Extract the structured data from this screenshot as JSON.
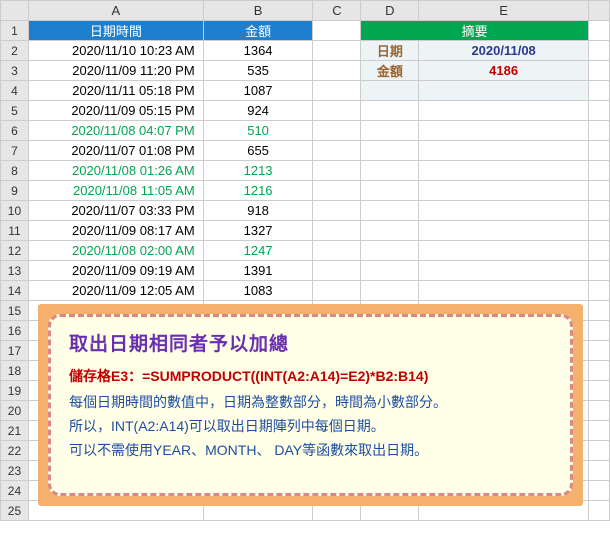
{
  "grid": {
    "columns": [
      "A",
      "B",
      "C",
      "D",
      "E",
      ""
    ],
    "header": {
      "ab_datetime": "日期時間",
      "ab_amount": "金額",
      "d_summary": "摘要"
    },
    "data": [
      {
        "dt": "2020/11/10 10:23 AM",
        "amt": "1364",
        "hl": false
      },
      {
        "dt": "2020/11/09 11:20 PM",
        "amt": "535",
        "hl": false
      },
      {
        "dt": "2020/11/11 05:18 PM",
        "amt": "1087",
        "hl": false
      },
      {
        "dt": "2020/11/09 05:15 PM",
        "amt": "924",
        "hl": false
      },
      {
        "dt": "2020/11/08 04:07 PM",
        "amt": "510",
        "hl": true
      },
      {
        "dt": "2020/11/07 01:08 PM",
        "amt": "655",
        "hl": false
      },
      {
        "dt": "2020/11/08 01:26 AM",
        "amt": "1213",
        "hl": true
      },
      {
        "dt": "2020/11/08 11:05 AM",
        "amt": "1216",
        "hl": true
      },
      {
        "dt": "2020/11/07 03:33 PM",
        "amt": "918",
        "hl": false
      },
      {
        "dt": "2020/11/09 08:17 AM",
        "amt": "1327",
        "hl": false
      },
      {
        "dt": "2020/11/08 02:00 AM",
        "amt": "1247",
        "hl": true
      },
      {
        "dt": "2020/11/09 09:19 AM",
        "amt": "1391",
        "hl": false
      },
      {
        "dt": "2020/11/09 12:05 AM",
        "amt": "1083",
        "hl": false
      }
    ],
    "summary": {
      "date_label": "日期",
      "date_value": "2020/11/08",
      "amt_label": "金額",
      "amt_value": "4186"
    }
  },
  "callout": {
    "title": "取出日期相同者予以加總",
    "formula": "儲存格E3：=SUMPRODUCT((INT(A2:A14)=E2)*B2:B14)",
    "line1": "每個日期時間的數值中，日期為整數部分，時間為小數部分。",
    "line2": "所以，INT(A2:A14)可以取出日期陣列中每個日期。",
    "line3": "可以不需使用YEAR、MONTH、 DAY等函數來取出日期。"
  },
  "chart_data": {
    "type": "table",
    "title": "SUMPRODUCT with INT date filter",
    "columns": [
      "日期時間",
      "金額"
    ],
    "rows": [
      [
        "2020/11/10 10:23 AM",
        1364
      ],
      [
        "2020/11/09 11:20 PM",
        535
      ],
      [
        "2020/11/11 05:18 PM",
        1087
      ],
      [
        "2020/11/09 05:15 PM",
        924
      ],
      [
        "2020/11/08 04:07 PM",
        510
      ],
      [
        "2020/11/07 01:08 PM",
        655
      ],
      [
        "2020/11/08 01:26 AM",
        1213
      ],
      [
        "2020/11/08 11:05 AM",
        1216
      ],
      [
        "2020/11/07 03:33 PM",
        918
      ],
      [
        "2020/11/09 08:17 AM",
        1327
      ],
      [
        "2020/11/08 02:00 AM",
        1247
      ],
      [
        "2020/11/09 09:19 AM",
        1391
      ],
      [
        "2020/11/09 12:05 AM",
        1083
      ]
    ],
    "summary": {
      "日期": "2020/11/08",
      "金額": 4186
    }
  }
}
